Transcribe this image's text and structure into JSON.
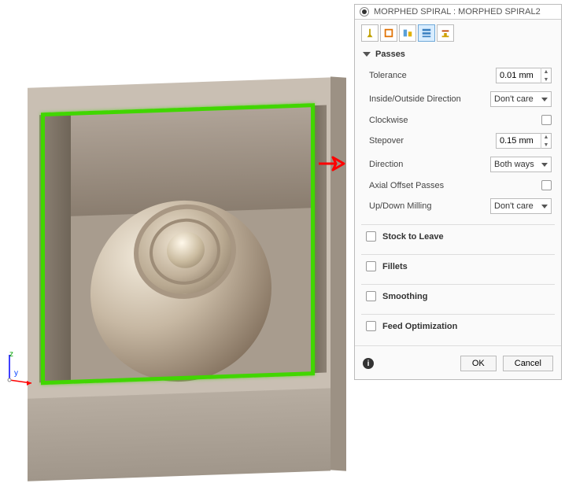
{
  "panel": {
    "title": "MORPHED SPIRAL : MORPHED SPIRAL2",
    "tabs": [
      {
        "name": "tool-tab"
      },
      {
        "name": "geometry-tab"
      },
      {
        "name": "heights-tab"
      },
      {
        "name": "passes-tab"
      },
      {
        "name": "linking-tab"
      }
    ],
    "active_tab_index": 3,
    "expanded_section": "Passes",
    "props": {
      "tolerance": {
        "label": "Tolerance",
        "value": "0.01 mm"
      },
      "inside_outside": {
        "label": "Inside/Outside Direction",
        "value": "Don't care"
      },
      "clockwise": {
        "label": "Clockwise",
        "checked": false
      },
      "stepover": {
        "label": "Stepover",
        "value": "0.15 mm"
      },
      "direction": {
        "label": "Direction",
        "value": "Both ways"
      },
      "axial_offset": {
        "label": "Axial Offset Passes",
        "checked": false
      },
      "updown": {
        "label": "Up/Down Milling",
        "value": "Don't care"
      }
    },
    "collapsed_sections": [
      "Stock to Leave",
      "Fillets",
      "Smoothing",
      "Feed Optimization"
    ],
    "buttons": {
      "ok": "OK",
      "cancel": "Cancel"
    }
  },
  "annotation": {
    "arrow_color": "#ff0000",
    "direction": "right"
  },
  "selection": {
    "highlight_color": "#41d600"
  },
  "axes": {
    "z": "z",
    "y": "y"
  }
}
